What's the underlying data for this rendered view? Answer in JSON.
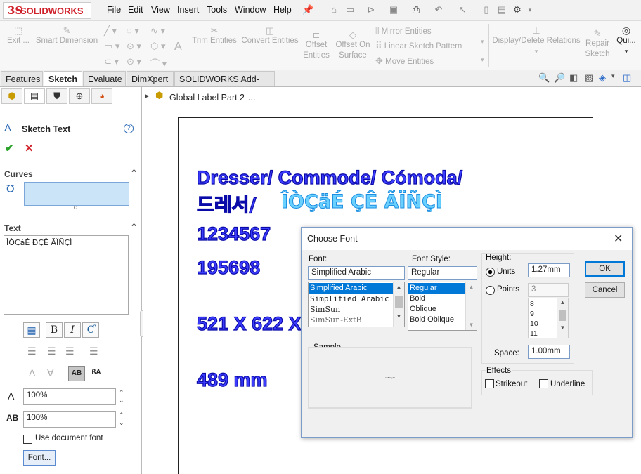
{
  "app": {
    "logo_ds": "3S",
    "logo_text": "SOLIDWORKS"
  },
  "menu": [
    "File",
    "Edit",
    "View",
    "Insert",
    "Tools",
    "Window",
    "Help"
  ],
  "ribbon": {
    "exit": "Exit ...",
    "smart_dimension": "Smart Dimension",
    "trim": "Trim Entities",
    "convert": "Convert Entities",
    "offset1": "Offset",
    "offset2": "Entities",
    "offset_surface1": "Offset On",
    "offset_surface2": "Surface",
    "mirror": "Mirror Entities",
    "linear_pattern": "Linear Sketch Pattern",
    "move": "Move Entities",
    "display_delete": "Display/Delete Relations",
    "repair1": "Repair",
    "repair2": "Sketch",
    "quick": "Qui..."
  },
  "tabs": [
    "Features",
    "Sketch",
    "Evaluate",
    "DimXpert",
    "SOLIDWORKS Add-Ins"
  ],
  "tree": {
    "label": "Global Label Part 2",
    "more": "..."
  },
  "panel": {
    "title": "Sketch Text",
    "curves_label": "Curves",
    "text_label": "Text",
    "text_value": "ÎÒÇáÉ ÐÇÊ ÃÏÑÇÌ",
    "width_value": "100%",
    "spacing_value": "100%",
    "use_doc_font": "Use document font",
    "font_button": "Font..."
  },
  "sketch": {
    "line1": "Dresser/ Commode/ Cómoda/",
    "line2a": "드레서/",
    "line2b": "ÎÒÇäÉ  ÇÊ ÃÏÑÇÌ",
    "line3": "1234567",
    "line4": "195698",
    "line5": "521 X 622 X",
    "line6": "489 mm"
  },
  "dialog": {
    "title": "Choose Font",
    "font_label": "Font:",
    "font_value": "Simplified Arabic",
    "fonts": [
      "Simplified Arabic",
      "Simplified Arabic",
      "SimSun",
      "SimSun-ExtB"
    ],
    "style_label": "Font Style:",
    "style_value": "Regular",
    "styles": [
      "Regular",
      "Bold",
      "Oblique",
      "Bold Oblique"
    ],
    "height_label": "Height:",
    "units_label": "Units",
    "units_value": "1.27mm",
    "points_label": "Points",
    "points_value": "3",
    "sizes": [
      "8",
      "9",
      "10",
      "11"
    ],
    "space_label": "Space:",
    "space_value": "1.00mm",
    "sample_label": "Sample",
    "sample_text": "AaBbYyZz",
    "effects_label": "Effects",
    "strikeout": "Strikeout",
    "underline": "Underline",
    "ok": "OK",
    "cancel": "Cancel"
  }
}
